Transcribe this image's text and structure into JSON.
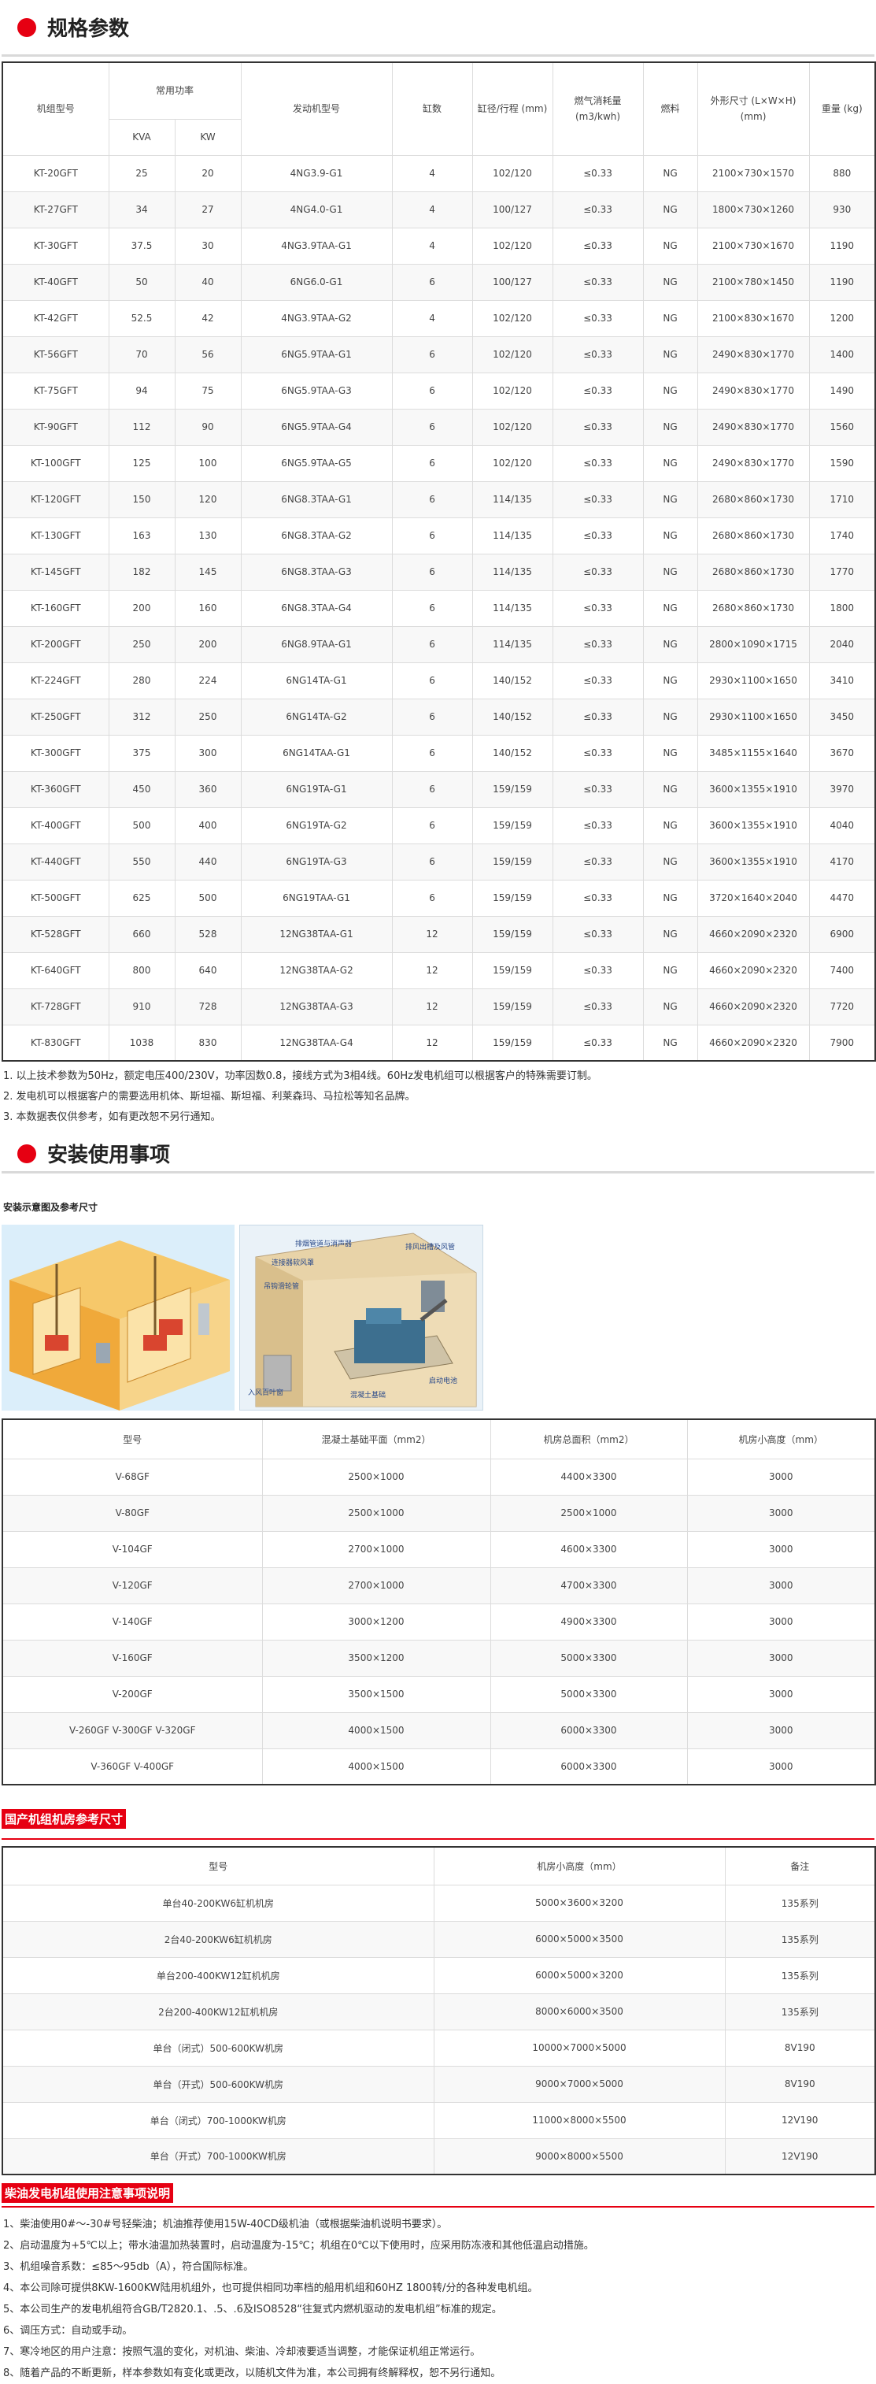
{
  "spec": {
    "title": "规格参数",
    "headers": {
      "model": "机组型号",
      "power": "常用功率",
      "engine": "发动机型号",
      "cyl": "缸数",
      "bore": "缸径/行程 (mm)",
      "gas_line1": "燃气消耗量",
      "gas_line2": "(m3/kwh)",
      "fuel": "燃料",
      "dim_line1": "外形尺寸 (L×W×H)",
      "dim_line2": "(mm)",
      "weight": "重量 (kg)",
      "kva": "KVA",
      "kw": "KW"
    },
    "rows": [
      [
        "KT-20GFT",
        "25",
        "20",
        "4NG3.9-G1",
        "4",
        "102/120",
        "≤0.33",
        "NG",
        "2100×730×1570",
        "880"
      ],
      [
        "KT-27GFT",
        "34",
        "27",
        "4NG4.0-G1",
        "4",
        "100/127",
        "≤0.33",
        "NG",
        "1800×730×1260",
        "930"
      ],
      [
        "KT-30GFT",
        "37.5",
        "30",
        "4NG3.9TAA-G1",
        "4",
        "102/120",
        "≤0.33",
        "NG",
        "2100×730×1670",
        "1190"
      ],
      [
        "KT-40GFT",
        "50",
        "40",
        "6NG6.0-G1",
        "6",
        "100/127",
        "≤0.33",
        "NG",
        "2100×780×1450",
        "1190"
      ],
      [
        "KT-42GFT",
        "52.5",
        "42",
        "4NG3.9TAA-G2",
        "4",
        "102/120",
        "≤0.33",
        "NG",
        "2100×830×1670",
        "1200"
      ],
      [
        "KT-56GFT",
        "70",
        "56",
        "6NG5.9TAA-G1",
        "6",
        "102/120",
        "≤0.33",
        "NG",
        "2490×830×1770",
        "1400"
      ],
      [
        "KT-75GFT",
        "94",
        "75",
        "6NG5.9TAA-G3",
        "6",
        "102/120",
        "≤0.33",
        "NG",
        "2490×830×1770",
        "1490"
      ],
      [
        "KT-90GFT",
        "112",
        "90",
        "6NG5.9TAA-G4",
        "6",
        "102/120",
        "≤0.33",
        "NG",
        "2490×830×1770",
        "1560"
      ],
      [
        "KT-100GFT",
        "125",
        "100",
        "6NG5.9TAA-G5",
        "6",
        "102/120",
        "≤0.33",
        "NG",
        "2490×830×1770",
        "1590"
      ],
      [
        "KT-120GFT",
        "150",
        "120",
        "6NG8.3TAA-G1",
        "6",
        "114/135",
        "≤0.33",
        "NG",
        "2680×860×1730",
        "1710"
      ],
      [
        "KT-130GFT",
        "163",
        "130",
        "6NG8.3TAA-G2",
        "6",
        "114/135",
        "≤0.33",
        "NG",
        "2680×860×1730",
        "1740"
      ],
      [
        "KT-145GFT",
        "182",
        "145",
        "6NG8.3TAA-G3",
        "6",
        "114/135",
        "≤0.33",
        "NG",
        "2680×860×1730",
        "1770"
      ],
      [
        "KT-160GFT",
        "200",
        "160",
        "6NG8.3TAA-G4",
        "6",
        "114/135",
        "≤0.33",
        "NG",
        "2680×860×1730",
        "1800"
      ],
      [
        "KT-200GFT",
        "250",
        "200",
        "6NG8.9TAA-G1",
        "6",
        "114/135",
        "≤0.33",
        "NG",
        "2800×1090×1715",
        "2040"
      ],
      [
        "KT-224GFT",
        "280",
        "224",
        "6NG14TA-G1",
        "6",
        "140/152",
        "≤0.33",
        "NG",
        "2930×1100×1650",
        "3410"
      ],
      [
        "KT-250GFT",
        "312",
        "250",
        "6NG14TA-G2",
        "6",
        "140/152",
        "≤0.33",
        "NG",
        "2930×1100×1650",
        "3450"
      ],
      [
        "KT-300GFT",
        "375",
        "300",
        "6NG14TAA-G1",
        "6",
        "140/152",
        "≤0.33",
        "NG",
        "3485×1155×1640",
        "3670"
      ],
      [
        "KT-360GFT",
        "450",
        "360",
        "6NG19TA-G1",
        "6",
        "159/159",
        "≤0.33",
        "NG",
        "3600×1355×1910",
        "3970"
      ],
      [
        "KT-400GFT",
        "500",
        "400",
        "6NG19TA-G2",
        "6",
        "159/159",
        "≤0.33",
        "NG",
        "3600×1355×1910",
        "4040"
      ],
      [
        "KT-440GFT",
        "550",
        "440",
        "6NG19TA-G3",
        "6",
        "159/159",
        "≤0.33",
        "NG",
        "3600×1355×1910",
        "4170"
      ],
      [
        "KT-500GFT",
        "625",
        "500",
        "6NG19TAA-G1",
        "6",
        "159/159",
        "≤0.33",
        "NG",
        "3720×1640×2040",
        "4470"
      ],
      [
        "KT-528GFT",
        "660",
        "528",
        "12NG38TAA-G1",
        "12",
        "159/159",
        "≤0.33",
        "NG",
        "4660×2090×2320",
        "6900"
      ],
      [
        "KT-640GFT",
        "800",
        "640",
        "12NG38TAA-G2",
        "12",
        "159/159",
        "≤0.33",
        "NG",
        "4660×2090×2320",
        "7400"
      ],
      [
        "KT-728GFT",
        "910",
        "728",
        "12NG38TAA-G3",
        "12",
        "159/159",
        "≤0.33",
        "NG",
        "4660×2090×2320",
        "7720"
      ],
      [
        "KT-830GFT",
        "1038",
        "830",
        "12NG38TAA-G4",
        "12",
        "159/159",
        "≤0.33",
        "NG",
        "4660×2090×2320",
        "7900"
      ]
    ],
    "notes": [
      "1. 以上技术参数为50Hz，额定电压400/230V，功率因数0.8，接线方式为3相4线。60Hz发电机组可以根据客户的特殊需要订制。",
      "2. 发电机可以根据客户的需要选用机体、斯坦福、斯坦福、利莱森玛、马拉松等知名品牌。",
      "3. 本数据表仅供参考，如有更改恕不另行通知。"
    ]
  },
  "install": {
    "title": "安装使用事项",
    "sublabel": "安装示意图及参考尺寸",
    "diagram_labels": {
      "l1": "排烟管道与消声器",
      "l2": "连接器软风罩",
      "l3": "吊钩滑轮管",
      "l4": "排风出槽及风管",
      "l5": "入风百叶窗",
      "l6": "启动电池",
      "l7": "混凝土基础"
    },
    "room_headers": [
      "型号",
      "混凝土基础平面（mm2）",
      "机房总面积（mm2）",
      "机房小高度（mm）"
    ],
    "room_rows": [
      [
        "V-68GF",
        "2500×1000",
        "4400×3300",
        "3000"
      ],
      [
        "V-80GF",
        "2500×1000",
        "2500×1000",
        "3000"
      ],
      [
        "V-104GF",
        "2700×1000",
        "4600×3300",
        "3000"
      ],
      [
        "V-120GF",
        "2700×1000",
        "4700×3300",
        "3000"
      ],
      [
        "V-140GF",
        "3000×1200",
        "4900×3300",
        "3000"
      ],
      [
        "V-160GF",
        "3500×1200",
        "5000×3300",
        "3000"
      ],
      [
        "V-200GF",
        "3500×1500",
        "5000×3300",
        "3000"
      ],
      [
        "V-260GF V-300GF V-320GF",
        "4000×1500",
        "6000×3300",
        "3000"
      ],
      [
        "V-360GF V-400GF",
        "4000×1500",
        "6000×3300",
        "3000"
      ]
    ]
  },
  "domestic": {
    "band_title": "国产机组机房参考尺寸",
    "headers": [
      "型号",
      "机房小高度（mm）",
      "备注"
    ],
    "rows": [
      [
        "单台40-200KW6缸机机房",
        "5000×3600×3200",
        "135系列"
      ],
      [
        "2台40-200KW6缸机机房",
        "6000×5000×3500",
        "135系列"
      ],
      [
        "单台200-400KW12缸机机房",
        "6000×5000×3200",
        "135系列"
      ],
      [
        "2台200-400KW12缸机机房",
        "8000×6000×3500",
        "135系列"
      ],
      [
        "单台（闭式）500-600KW机房",
        "10000×7000×5000",
        "8V190"
      ],
      [
        "单台（开式）500-600KW机房",
        "9000×7000×5000",
        "8V190"
      ],
      [
        "单台（闭式）700-1000KW机房",
        "11000×8000×5500",
        "12V190"
      ],
      [
        "单台（开式）700-1000KW机房",
        "9000×8000×5500",
        "12V190"
      ]
    ]
  },
  "usage": {
    "band_title": "柴油发电机组使用注意事项说明",
    "notes": [
      "1、柴油使用0#～-30#号轻柴油；机油推荐使用15W-40CD级机油（或根据柴油机说明书要求）。",
      "2、启动温度为+5℃以上；带水油温加热装置时，启动温度为-15℃；机组在0℃以下使用时，应采用防冻液和其他低温启动措施。",
      "3、机组噪音系数：≤85～95db（A），符合国际标准。",
      "4、本公司除可提供8KW-1600KW陆用机组外，也可提供相同功率档的船用机组和60HZ 1800转/分的各种发电机组。",
      "5、本公司生产的发电机组符合GB/T2820.1、.5、.6及ISO8528“往复式内燃机驱动的发电机组”标准的规定。",
      "6、调压方式：自动或手动。",
      "7、寒冷地区的用户注意：按照气温的变化，对机油、柴油、冷却液要适当调整，才能保证机组正常运行。",
      "8、随着产品的不断更新，样本参数如有变化或更改，以随机文件为准，本公司拥有终解释权，恕不另行通知。"
    ]
  },
  "colors": {
    "accent": "#e60012",
    "border": "#dcdcdc"
  }
}
